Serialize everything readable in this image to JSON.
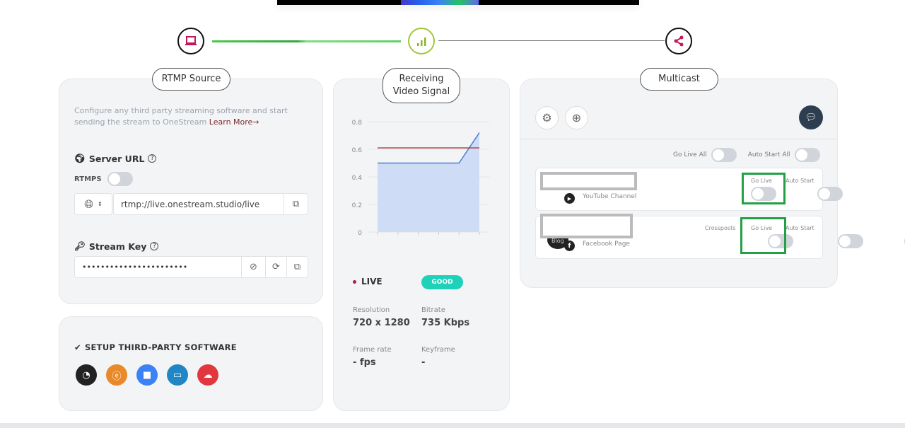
{
  "stepper": {
    "steps": [
      {
        "icon": "laptop-icon"
      },
      {
        "icon": "signal-icon"
      },
      {
        "icon": "share-icon"
      }
    ],
    "progress_percent": 50
  },
  "rtmp": {
    "title": "RTMP Source",
    "description": "Configure any third party streaming software and start sending the stream to OneStream",
    "learn_more": "Learn More→",
    "server_url_label": "Server URL",
    "rtmps_label": "RTMPS",
    "rtmps_on": false,
    "server_url": "rtmp://live.onestream.studio/live",
    "stream_key_label": "Stream Key",
    "stream_key": "•••••••••••••••••••••••"
  },
  "setup": {
    "title": "SETUP THIRD-PARTY SOFTWARE",
    "apps": [
      {
        "icon": "obs-icon",
        "color": "#222222"
      },
      {
        "icon": "ecamm-icon",
        "color": "#e8892b"
      },
      {
        "icon": "zoom-icon",
        "color": "#3b82f6"
      },
      {
        "icon": "streamyard-icon",
        "color": "#2186c4"
      },
      {
        "icon": "cloud-download-icon",
        "color": "#e0383e"
      }
    ]
  },
  "signal": {
    "title": "Receiving Video Signal",
    "status": "LIVE",
    "quality": "GOOD",
    "resolution_label": "Resolution",
    "resolution": "720 x 1280",
    "bitrate_label": "Bitrate",
    "bitrate": "735 Kbps",
    "framerate_label": "Frame rate",
    "framerate": "- fps",
    "keyframe_label": "Keyframe",
    "keyframe": "-"
  },
  "chart_data": {
    "type": "area",
    "yticks": [
      "0",
      "0.2",
      "0.4",
      "0.6",
      "0.8"
    ],
    "ylim": [
      0,
      0.8
    ],
    "x": [
      1,
      2,
      3,
      4,
      5,
      6
    ],
    "series": [
      {
        "values": [
          0.5,
          0.5,
          0.5,
          0.5,
          0.5,
          0.72
        ],
        "color": "#4a7fd4"
      }
    ],
    "reference_line": {
      "value": 0.61,
      "color": "#a33b3b"
    },
    "grid": true
  },
  "multicast": {
    "title": "Multicast",
    "go_live_all": "Go Live All",
    "auto_start_all": "Auto Start All",
    "channels": [
      {
        "type": "YouTube Channel",
        "badge": "youtube-icon",
        "go_live": "Go Live",
        "auto_start": "Auto Start"
      },
      {
        "type": "Facebook Page",
        "badge": "facebook-icon",
        "crossposts": "Crossposts",
        "go_live": "Go Live",
        "auto_start": "Auto Start",
        "avatar_text": "Blog"
      }
    ]
  }
}
